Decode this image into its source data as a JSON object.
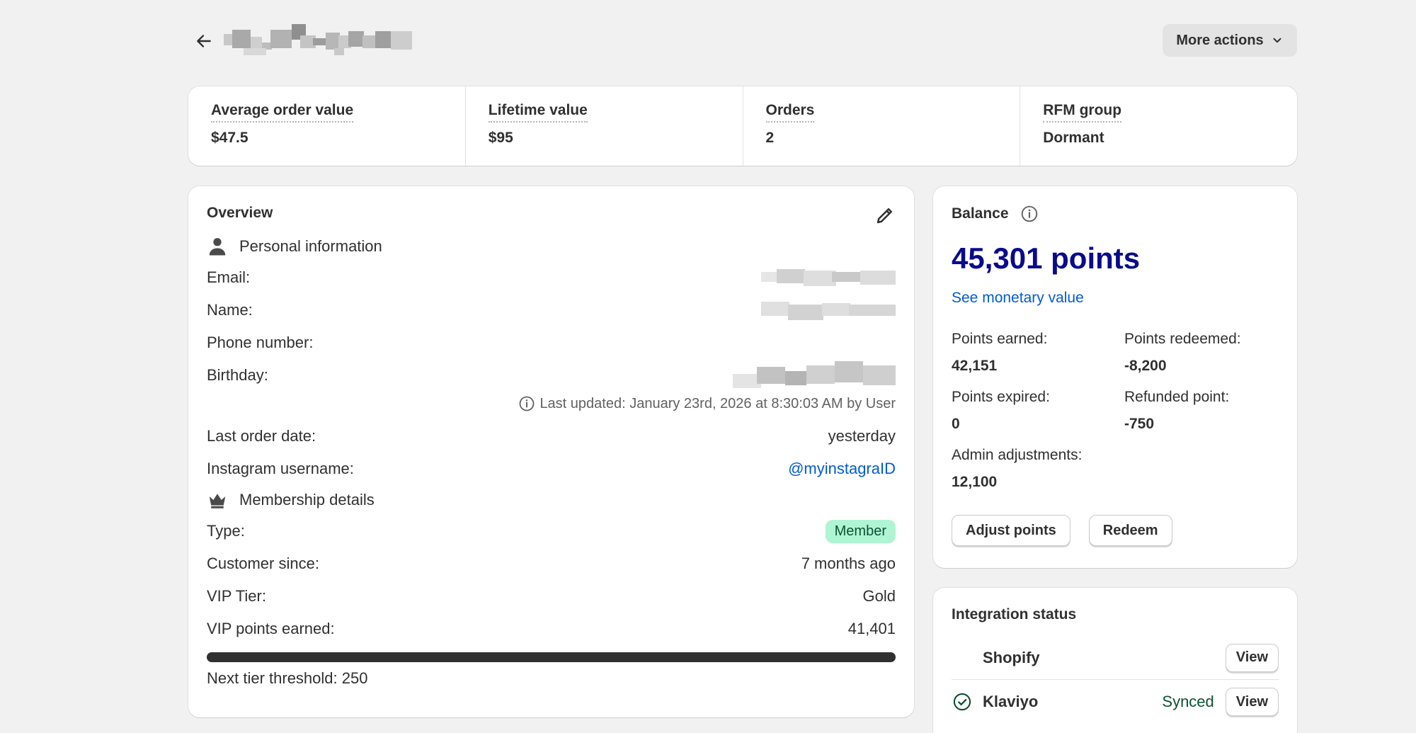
{
  "header": {
    "back_icon": "arrow-left-icon",
    "more_actions_label": "More actions",
    "chevron_icon": "chevron-down-icon"
  },
  "stats": [
    {
      "label": "Average order value",
      "value": "$47.5"
    },
    {
      "label": "Lifetime value",
      "value": "$95"
    },
    {
      "label": "Orders",
      "value": "2"
    },
    {
      "label": "RFM group",
      "value": "Dormant"
    }
  ],
  "overview": {
    "title": "Overview",
    "personal_info_heading": "Personal information",
    "email_label": "Email:",
    "name_label": "Name:",
    "phone_label": "Phone number:",
    "birthday_label": "Birthday:",
    "last_updated": "Last updated: January 23rd, 2026 at 8:30:03 AM by User",
    "last_order_label": "Last order date:",
    "last_order_value": "yesterday",
    "instagram_label": "Instagram username:",
    "instagram_value": "@myinstagraID",
    "membership_heading": "Membership details",
    "type_label": "Type:",
    "type_value": "Member",
    "customer_since_label": "Customer since:",
    "customer_since_value": "7 months ago",
    "vip_tier_label": "VIP Tier:",
    "vip_tier_value": "Gold",
    "vip_points_label": "VIP points earned:",
    "vip_points_value": "41,401",
    "progress_fraction": 1.0,
    "next_tier": "Next tier threshold: 250"
  },
  "balance": {
    "title": "Balance",
    "points": "45,301 points",
    "see_monetary": "See monetary value",
    "points_earned_label": "Points earned:",
    "points_earned_value": "42,151",
    "points_redeemed_label": "Points redeemed:",
    "points_redeemed_value": "-8,200",
    "points_expired_label": "Points expired:",
    "points_expired_value": "0",
    "refunded_label": "Refunded point:",
    "refunded_value": "-750",
    "admin_adj_label": "Admin adjustments:",
    "admin_adj_value": "12,100",
    "adjust_btn": "Adjust points",
    "redeem_btn": "Redeem"
  },
  "integration": {
    "title": "Integration status",
    "items": [
      {
        "name": "Shopify",
        "status": "",
        "view": "View"
      },
      {
        "name": "Klaviyo",
        "status": "Synced",
        "view": "View"
      }
    ]
  },
  "colors": {
    "accent_link": "#005bd3",
    "points_color": "#0a0a8c",
    "badge_bg": "#aff5d4",
    "synced_green": "#0c5132"
  }
}
